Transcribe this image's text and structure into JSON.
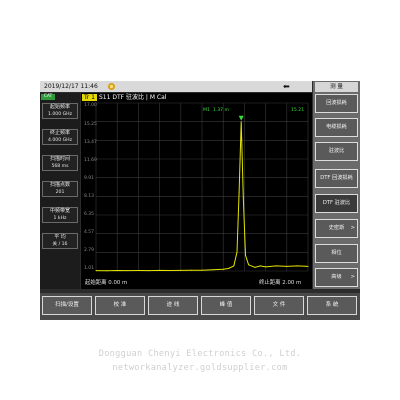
{
  "status": {
    "datetime": "2019/12/17 11:46"
  },
  "left_panel": {
    "cat_label": "CAT",
    "params": [
      {
        "label": "起始频率",
        "value": "1.000 GHz"
      },
      {
        "label": "终止频率",
        "value": "4.000 GHz"
      },
      {
        "label": "扫描时间",
        "value": "568 ms"
      },
      {
        "label": "扫描点数",
        "value": "201"
      },
      {
        "label": "中频带宽",
        "value": "1 kHz"
      },
      {
        "label": "平 均",
        "value": "关 / 16"
      }
    ]
  },
  "plot": {
    "trace_label": "Tr 1",
    "trace_desc": "S11 DTF 驻波比 | M Cal",
    "y_ticks": [
      "17.00",
      "15.25",
      "13.47",
      "11.69",
      "9.91",
      "8.13",
      "6.35",
      "4.57",
      "2.79",
      "1.01"
    ],
    "marker": {
      "name": "M1",
      "position": "1.37 m",
      "value": "15.21"
    },
    "x_start_label": "起始距离",
    "x_start_value": "0.00 m",
    "x_end_label": "终止距离",
    "x_end_value": "2.00 m",
    "colors": {
      "trace": "#e6e600",
      "marker": "#3ddc3d",
      "grid": "#3a3a3a"
    }
  },
  "chart_data": {
    "type": "line",
    "title": "S11 DTF 驻波比",
    "xlabel": "",
    "ylabel": "",
    "xlim": [
      0.0,
      2.0
    ],
    "ylim": [
      1.01,
      17.0
    ],
    "x": [
      0.0,
      0.1,
      0.2,
      0.3,
      0.4,
      0.5,
      0.6,
      0.7,
      0.8,
      0.9,
      1.0,
      1.1,
      1.2,
      1.25,
      1.3,
      1.33,
      1.35,
      1.37,
      1.39,
      1.41,
      1.44,
      1.5,
      1.55,
      1.6,
      1.7,
      1.8,
      1.9,
      2.0
    ],
    "series": [
      {
        "values": [
          1.05,
          1.04,
          1.06,
          1.05,
          1.06,
          1.05,
          1.07,
          1.06,
          1.07,
          1.08,
          1.09,
          1.12,
          1.18,
          1.25,
          1.5,
          2.8,
          8.5,
          15.21,
          8.0,
          2.5,
          1.6,
          1.35,
          1.5,
          1.4,
          1.5,
          1.45,
          1.5,
          1.45
        ]
      }
    ]
  },
  "right_menu": {
    "title": "测 量",
    "items": [
      {
        "label": "回波损耗",
        "arrow": ""
      },
      {
        "label": "电缆损耗",
        "arrow": ""
      },
      {
        "label": "驻波比",
        "arrow": ""
      },
      {
        "label": "DTF 回波损耗",
        "arrow": ""
      },
      {
        "label": "DTF 驻波比",
        "arrow": ""
      },
      {
        "label": "史密斯",
        "arrow": ">"
      },
      {
        "label": "相位",
        "arrow": ""
      },
      {
        "label": "高级",
        "arrow": ">"
      }
    ]
  },
  "bottom_menu": [
    "扫描/设置",
    "校 准",
    "迹 线",
    "峰 值",
    "文 件",
    "系 统"
  ],
  "watermark": {
    "line1": "Dongguan Chenyi Electronics Co., Ltd.",
    "line2": "networkanalyzer.goldsupplier.com"
  }
}
